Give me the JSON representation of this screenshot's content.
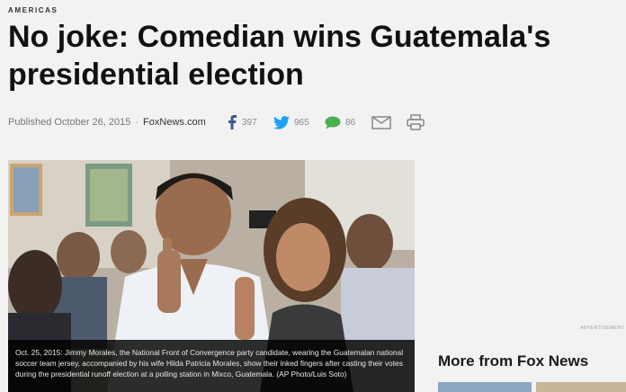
{
  "article": {
    "section": "AMERICAS",
    "headline": "No joke: Comedian wins Guatemala's presidential election",
    "published": "Published October 26, 2015",
    "source": "FoxNews.com"
  },
  "share": {
    "facebook_count": "397",
    "twitter_count": "965",
    "comments_count": "86"
  },
  "photo": {
    "caption": "Oct. 25, 2015: Jimmy Morales, the National Front of Convergence party candidate, wearing the Guatemalan national soccer team jersey, accompanied by his wife Hilda Patricia Morales, show their inked fingers after casting their votes during the presidential runoff election at a polling station in Mixco, Guatemala. (AP Photo/Luis Soto)"
  },
  "sidebar": {
    "ad_label": "ADVERTISEMENT",
    "more_title": "More from Fox News"
  },
  "colors": {
    "facebook": "#3b5998",
    "twitter": "#1da1f2",
    "comment": "#4caf50",
    "icon_gray": "#888888"
  }
}
